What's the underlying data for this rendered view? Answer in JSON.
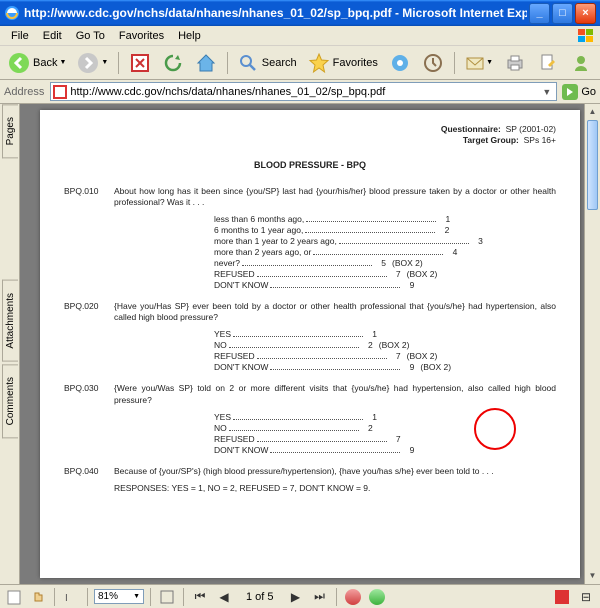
{
  "window": {
    "title": "http://www.cdc.gov/nchs/data/nhanes/nhanes_01_02/sp_bpq.pdf - Microsoft Internet Explorer"
  },
  "menu": {
    "file": "File",
    "edit": "Edit",
    "goto": "Go To",
    "favorites": "Favorites",
    "help": "Help"
  },
  "toolbar": {
    "back": "Back",
    "search": "Search",
    "favorites": "Favorites"
  },
  "address": {
    "label": "Address",
    "url": "http://www.cdc.gov/nchs/data/nhanes/nhanes_01_02/sp_bpq.pdf",
    "go": "Go"
  },
  "sidetabs": {
    "pages": "Pages",
    "attachments": "Attachments",
    "comments": "Comments"
  },
  "doc": {
    "meta": {
      "q_label": "Questionnaire:",
      "q_val": "SP (2001-02)",
      "tg_label": "Target Group:",
      "tg_val": "SPs 16+"
    },
    "title": "BLOOD PRESSURE - BPQ",
    "q010": {
      "code": "BPQ.010",
      "text": "About how long has it been since {you/SP} last had {your/his/her} blood pressure taken by a doctor or other health professional?  Was it . . .",
      "opts": [
        {
          "label": "less than 6 months ago,",
          "code": "1",
          "box": ""
        },
        {
          "label": "6 months to 1 year ago,",
          "code": "2",
          "box": ""
        },
        {
          "label": "more than 1 year to 2 years ago,",
          "code": "3",
          "box": ""
        },
        {
          "label": "more than 2 years ago, or",
          "code": "4",
          "box": ""
        },
        {
          "label": "never?",
          "code": "5",
          "box": "(BOX 2)"
        },
        {
          "label": "REFUSED",
          "code": "7",
          "box": "(BOX 2)"
        },
        {
          "label": "DON'T KNOW",
          "code": "9",
          "box": ""
        }
      ]
    },
    "q020": {
      "code": "BPQ.020",
      "text": "{Have you/Has SP} ever been told by a doctor or other health professional that {you/s/he} had hypertension, also called high blood pressure?",
      "opts": [
        {
          "label": "YES",
          "code": "1",
          "box": ""
        },
        {
          "label": "NO",
          "code": "2",
          "box": "(BOX 2)"
        },
        {
          "label": "REFUSED",
          "code": "7",
          "box": "(BOX 2)"
        },
        {
          "label": "DON'T KNOW",
          "code": "9",
          "box": "(BOX 2)"
        }
      ]
    },
    "q030": {
      "code": "BPQ.030",
      "text": "{Were you/Was SP} told on 2 or more different visits that {you/s/he} had hypertension, also called high blood pressure?",
      "opts": [
        {
          "label": "YES",
          "code": "1",
          "box": ""
        },
        {
          "label": "NO",
          "code": "2",
          "box": ""
        },
        {
          "label": "REFUSED",
          "code": "7",
          "box": ""
        },
        {
          "label": "DON'T KNOW",
          "code": "9",
          "box": ""
        }
      ]
    },
    "q040": {
      "code": "BPQ.040",
      "text": "Because of {your/SP's} (high blood pressure/hypertension), {have you/has s/he} ever been told to . . .",
      "resp": "RESPONSES:  YES = 1, NO = 2, REFUSED = 7, DON'T KNOW = 9."
    }
  },
  "pdfbar": {
    "zoom": "81%",
    "page": "1 of 5"
  }
}
